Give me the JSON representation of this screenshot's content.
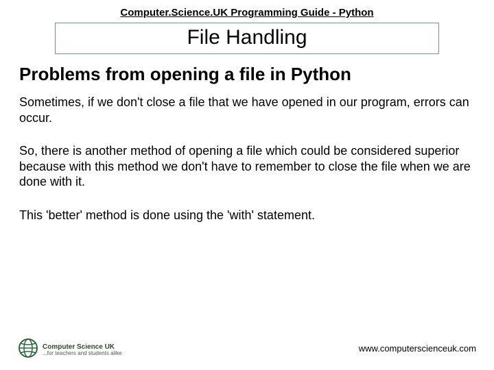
{
  "header": "Computer.Science.UK Programming Guide - Python",
  "title": "File Handling",
  "heading": "Problems from opening a file in Python",
  "paragraphs": {
    "p1": "Sometimes, if we don't close a file that we have opened in our program, errors can occur.",
    "p2": "So, there is another method of opening a file which could be considered superior because with this method we don't have to remember to close the file when we are done with it.",
    "p3": "This 'better' method is done using the 'with' statement."
  },
  "logo": {
    "line1": "Computer Science UK",
    "line2": "...for teachers and students alike"
  },
  "url": "www.computerscienceuk.com"
}
